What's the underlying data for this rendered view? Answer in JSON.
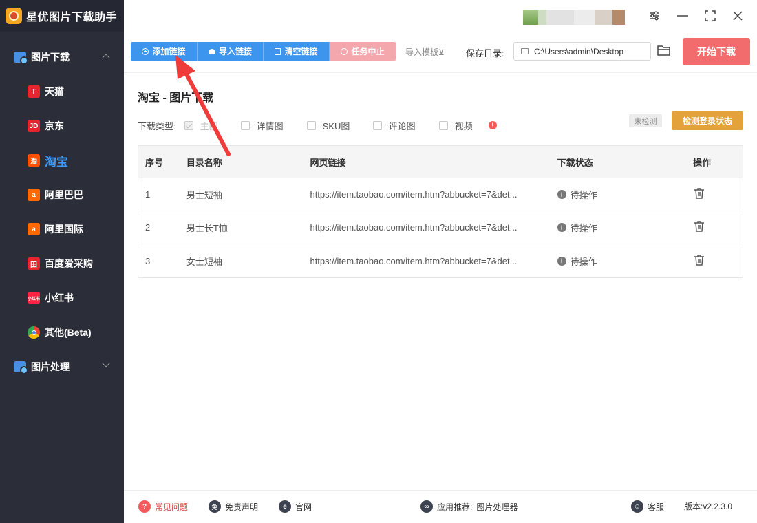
{
  "app": {
    "title": "星优图片下载助手"
  },
  "sidebar": {
    "group1": "图片下载",
    "items": [
      {
        "label": "天猫",
        "icon": "T",
        "icon_name": "tmall-icon",
        "color": "#e5262e"
      },
      {
        "label": "京东",
        "icon": "JD",
        "icon_name": "jd-icon",
        "color": "#e5262e"
      },
      {
        "label": "淘宝",
        "icon": "淘",
        "icon_name": "taobao-icon",
        "color": "#ff5000"
      },
      {
        "label": "阿里巴巴",
        "icon": "a",
        "icon_name": "alibaba-icon",
        "color": "#ff6a00"
      },
      {
        "label": "阿里国际",
        "icon": "a",
        "icon_name": "alibaba-intl-icon",
        "color": "#ff6a00"
      },
      {
        "label": "百度爱采购",
        "icon": "田",
        "icon_name": "baidu-purchase-icon",
        "color": "#e5262e"
      },
      {
        "label": "小红书",
        "icon": "小红书",
        "icon_name": "xiaohongshu-icon",
        "color": "#ff2442"
      },
      {
        "label": "其他(Beta)",
        "icon": "",
        "icon_name": "chrome-icon",
        "color": "#ffffff"
      }
    ],
    "group2": "图片处理"
  },
  "toolbar": {
    "add_link": "添加链接",
    "import_link": "导入链接",
    "clear_link": "清空链接",
    "stop_task": "任务中止",
    "import_template": "导入模板⊻",
    "save_dir_label": "保存目录:",
    "save_dir_value": "C:\\Users\\admin\\Desktop",
    "start_download": "开始下载"
  },
  "main": {
    "title": "淘宝 - 图片下载",
    "download_type_label": "下载类型:",
    "types": [
      {
        "label": "主图",
        "checked": true,
        "disabled": true
      },
      {
        "label": "详情图",
        "checked": false
      },
      {
        "label": "SKU图",
        "checked": false
      },
      {
        "label": "评论图",
        "checked": false
      },
      {
        "label": "视频",
        "checked": false
      }
    ],
    "login_status": "未检测",
    "check_login": "检测登录状态"
  },
  "table": {
    "headers": [
      "序号",
      "目录名称",
      "网页链接",
      "下载状态",
      "操作"
    ],
    "rows": [
      {
        "index": "1",
        "name": "男士短袖",
        "url": "https://item.taobao.com/item.htm?abbucket=7&det...",
        "status": "待操作"
      },
      {
        "index": "2",
        "name": "男士长T恤",
        "url": "https://item.taobao.com/item.htm?abbucket=7&det...",
        "status": "待操作"
      },
      {
        "index": "3",
        "name": "女士短袖",
        "url": "https://item.taobao.com/item.htm?abbucket=7&det...",
        "status": "待操作"
      }
    ]
  },
  "footer": {
    "faq": "常见问题",
    "disclaimer": "免责声明",
    "website": "官网",
    "recommend_label": "应用推荐:",
    "recommend_app": "图片处理器",
    "service": "客服",
    "version": "版本:v2.2.3.0"
  },
  "colors": {
    "primary": "#3d95ee",
    "danger": "#f26c6e",
    "warning": "#e4a23a",
    "sidebar_bg": "#2b2e38",
    "active": "#3a9bff"
  }
}
